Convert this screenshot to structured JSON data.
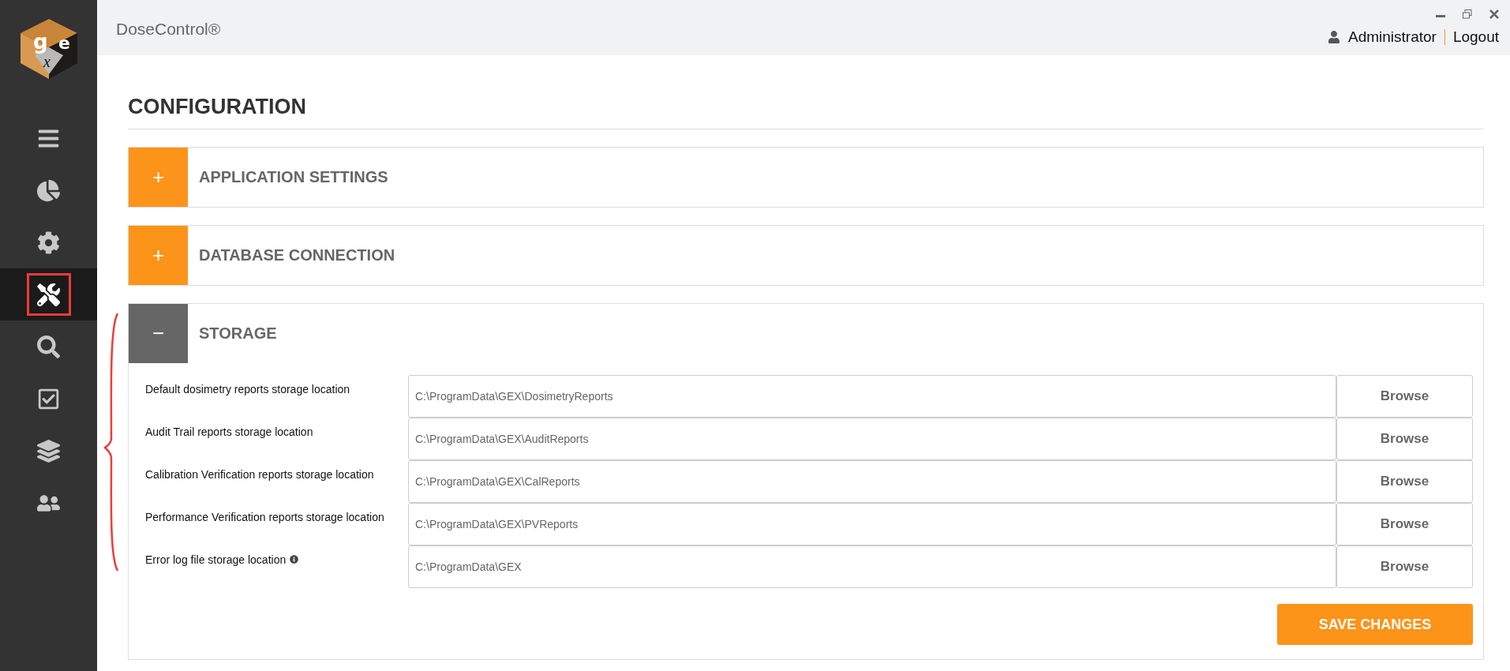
{
  "logo": {
    "letters": [
      "g",
      "e",
      "x"
    ]
  },
  "sidebar": {
    "items": [
      {
        "kind": "menu",
        "selected": false
      },
      {
        "kind": "dashboard",
        "selected": false
      },
      {
        "kind": "settings",
        "selected": false
      },
      {
        "kind": "tools",
        "selected": true
      },
      {
        "kind": "inspect",
        "selected": false
      },
      {
        "kind": "tasks",
        "selected": false
      },
      {
        "kind": "layers",
        "selected": false
      },
      {
        "kind": "users",
        "selected": false
      }
    ]
  },
  "header": {
    "app_name": "DoseControl®",
    "user": "Administrator",
    "logout": "Logout"
  },
  "page_title": "CONFIGURATION",
  "sections": [
    {
      "title": "APPLICATION SETTINGS",
      "expanded": false,
      "toggle": "+"
    },
    {
      "title": "DATABASE CONNECTION",
      "expanded": false,
      "toggle": "+"
    },
    {
      "title": "STORAGE",
      "expanded": true,
      "toggle": "−",
      "rows": [
        {
          "label": "Default dosimetry reports storage location",
          "value": "C:\\ProgramData\\GEX\\DosimetryReports",
          "button": "Browse",
          "info": false
        },
        {
          "label": "Audit Trail reports storage location",
          "value": "C:\\ProgramData\\GEX\\AuditReports",
          "button": "Browse",
          "info": false
        },
        {
          "label": "Calibration Verification reports storage location",
          "value": "C:\\ProgramData\\GEX\\CalReports",
          "button": "Browse",
          "info": false
        },
        {
          "label": "Performance Verification reports storage location",
          "value": "C:\\ProgramData\\GEX\\PVReports",
          "button": "Browse",
          "info": false
        },
        {
          "label": "Error log file storage location",
          "value": "C:\\ProgramData\\GEX",
          "button": "Browse",
          "info": true
        }
      ],
      "save": "SAVE CHANGES"
    }
  ]
}
